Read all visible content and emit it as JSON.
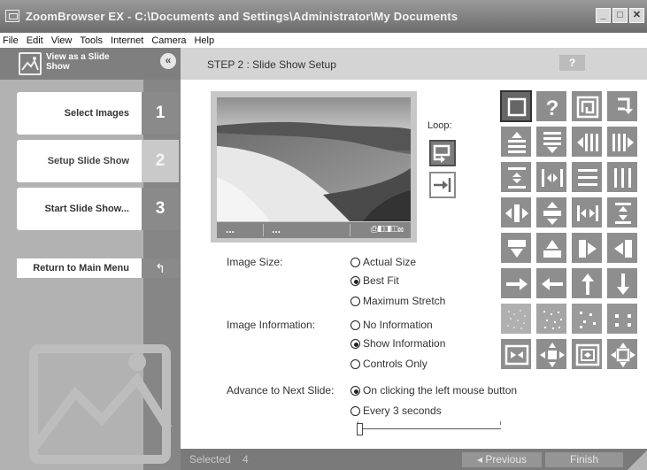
{
  "window": {
    "title": "ZoomBrowser EX  -  C:\\Documents and Settings\\Administrator\\My Documents",
    "minimize": "_",
    "maximize": "□",
    "close": "✕"
  },
  "menu": [
    "File",
    "Edit",
    "View",
    "Tools",
    "Internet",
    "Camera",
    "Help"
  ],
  "sidebar": {
    "header_title": "View as a Slide Show",
    "collapse_glyph": "«",
    "steps": [
      {
        "label": "Select Images",
        "num": "1"
      },
      {
        "label": "Setup Slide Show",
        "num": "2"
      },
      {
        "label": "Start Slide Show...",
        "num": "3"
      }
    ],
    "return_label": "Return to Main Menu",
    "return_glyph": "↰"
  },
  "main": {
    "step_title": "STEP 2 : Slide Show Setup",
    "help_label": "?",
    "preview": {
      "left_dots": "...",
      "mid_dots": "...",
      "controls": "⎙◧◨◫⊠"
    },
    "loop_label": "Loop:",
    "loop_buttons": [
      "loop-repeat-icon",
      "loop-once-icon"
    ],
    "effects": [
      "none-icon",
      "random-icon",
      "spiral-in-icon",
      "corner-icon",
      "wipe-up-icon",
      "wipe-down-icon",
      "wipe-left-icon",
      "wipe-right-icon",
      "split-vertical-icon",
      "split-horizontal-icon",
      "blinds-horizontal-icon",
      "blinds-vertical-icon",
      "push-horizontal-icon",
      "push-vertical-icon",
      "squeeze-horizontal-icon",
      "squeeze-vertical-icon",
      "cover-down-icon",
      "cover-up-icon",
      "cover-right-icon",
      "cover-left-icon",
      "arrow-right-icon",
      "arrow-left-icon",
      "arrow-up-icon",
      "arrow-down-icon",
      "dissolve-fine-icon",
      "dissolve-medium-icon",
      "dissolve-coarse-icon",
      "dissolve-large-icon",
      "zoom-in-h-icon",
      "expand-cross-icon",
      "zoom-box-icon",
      "expand-cross-out-icon"
    ],
    "image_size": {
      "label": "Image Size:",
      "options": [
        "Actual Size",
        "Best Fit",
        "Maximum Stretch"
      ],
      "selected": "Best Fit"
    },
    "image_info": {
      "label": "Image Information:",
      "options": [
        "No Information",
        "Show Information",
        "Controls Only"
      ],
      "selected": "Show Information"
    },
    "advance": {
      "label": "Advance to Next Slide:",
      "options": [
        "On clicking the left mouse button",
        "Every 3 seconds"
      ],
      "selected": "On clicking the left mouse button",
      "slider_value": 0
    },
    "footer": {
      "selected_label": "Selected",
      "selected_count": "4",
      "previous_label": "◂ Previous",
      "finish_label": "Finish"
    }
  }
}
